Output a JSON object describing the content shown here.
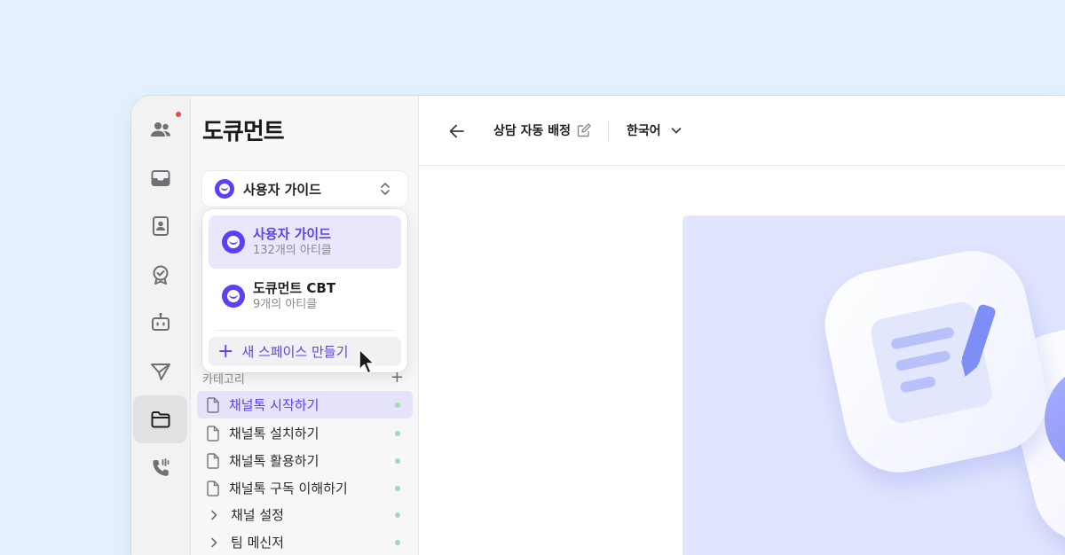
{
  "sidebar": {
    "title": "도큐먼트",
    "space_select": {
      "selected": "사용자 가이드",
      "icon": "chevron-updown-icon"
    },
    "category_header": "카테고리",
    "items": [
      {
        "label": "채널톡 시작하기",
        "type": "document",
        "active": true
      },
      {
        "label": "채널톡 설치하기",
        "type": "document"
      },
      {
        "label": "채널톡 활용하기",
        "type": "document"
      },
      {
        "label": "채널톡 구독 이해하기",
        "type": "document"
      },
      {
        "label": "채널 설정",
        "type": "folder"
      },
      {
        "label": "팀 메신저",
        "type": "folder"
      }
    ]
  },
  "dropdown": {
    "spaces": [
      {
        "name": "사용자 가이드",
        "count": "132개의 아티클",
        "selected": true
      },
      {
        "name": "도큐먼트 CBT",
        "count": "9개의 아티클"
      }
    ],
    "create_label": "새 스페이스 만들기"
  },
  "rail": {
    "items": [
      "team-icon",
      "inbox-icon",
      "contacts-icon",
      "badge-icon",
      "bot-icon",
      "send-icon",
      "folder-icon",
      "call-icon"
    ],
    "active": "folder-icon"
  },
  "header": {
    "title": "상담 자동 배정",
    "language": "한국어"
  },
  "colors": {
    "accent": "#5b44e8",
    "brand": "#5d3ff5",
    "background": "#e5f1fd",
    "status_dot": "#9ddbb0"
  }
}
